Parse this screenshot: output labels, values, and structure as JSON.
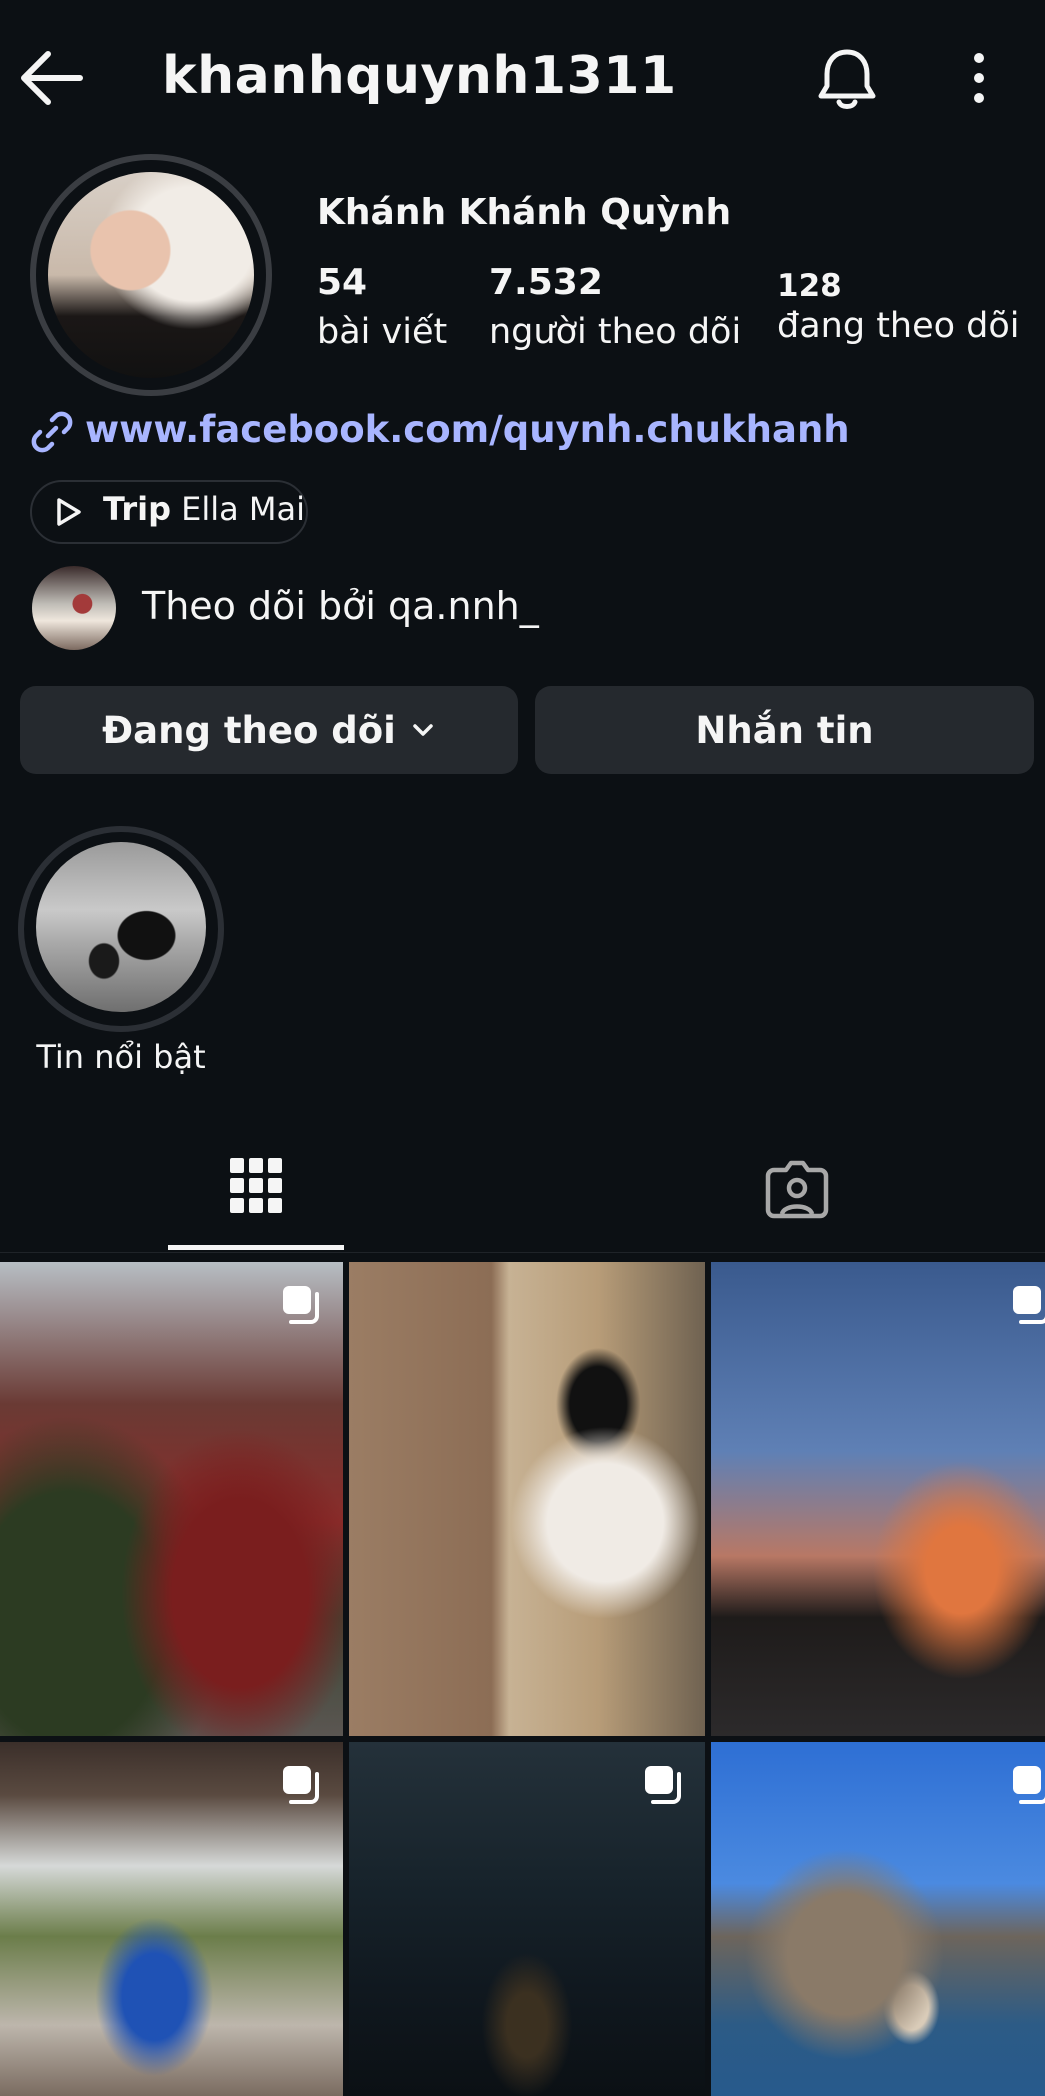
{
  "header": {
    "username": "khanhquynh1311",
    "icons": [
      "back-arrow-icon",
      "bell-icon",
      "more-vertical-icon"
    ]
  },
  "profile": {
    "display_name": "Khánh Khánh Quỳnh",
    "stats": [
      {
        "value": "54",
        "label": "bài viết"
      },
      {
        "value": "7.532",
        "label": "người theo dõi"
      },
      {
        "value": "128",
        "label": "đang theo dõi"
      }
    ],
    "link": "www.facebook.com/quynh.chukhanh",
    "chip": {
      "bold": "Trip",
      "text": " Ella Mai"
    },
    "followed_by": "Theo dõi bởi qa.nnh_"
  },
  "actions": {
    "follow_label": "Đang theo dõi",
    "message_label": "Nhắn tin"
  },
  "highlights": [
    {
      "label": "Tin nổi bật"
    }
  ],
  "tabs": [
    "grid-icon",
    "tagged-icon"
  ],
  "colors": {
    "background": "#0c1014",
    "button": "#25292e",
    "link": "#a8b5ff"
  }
}
